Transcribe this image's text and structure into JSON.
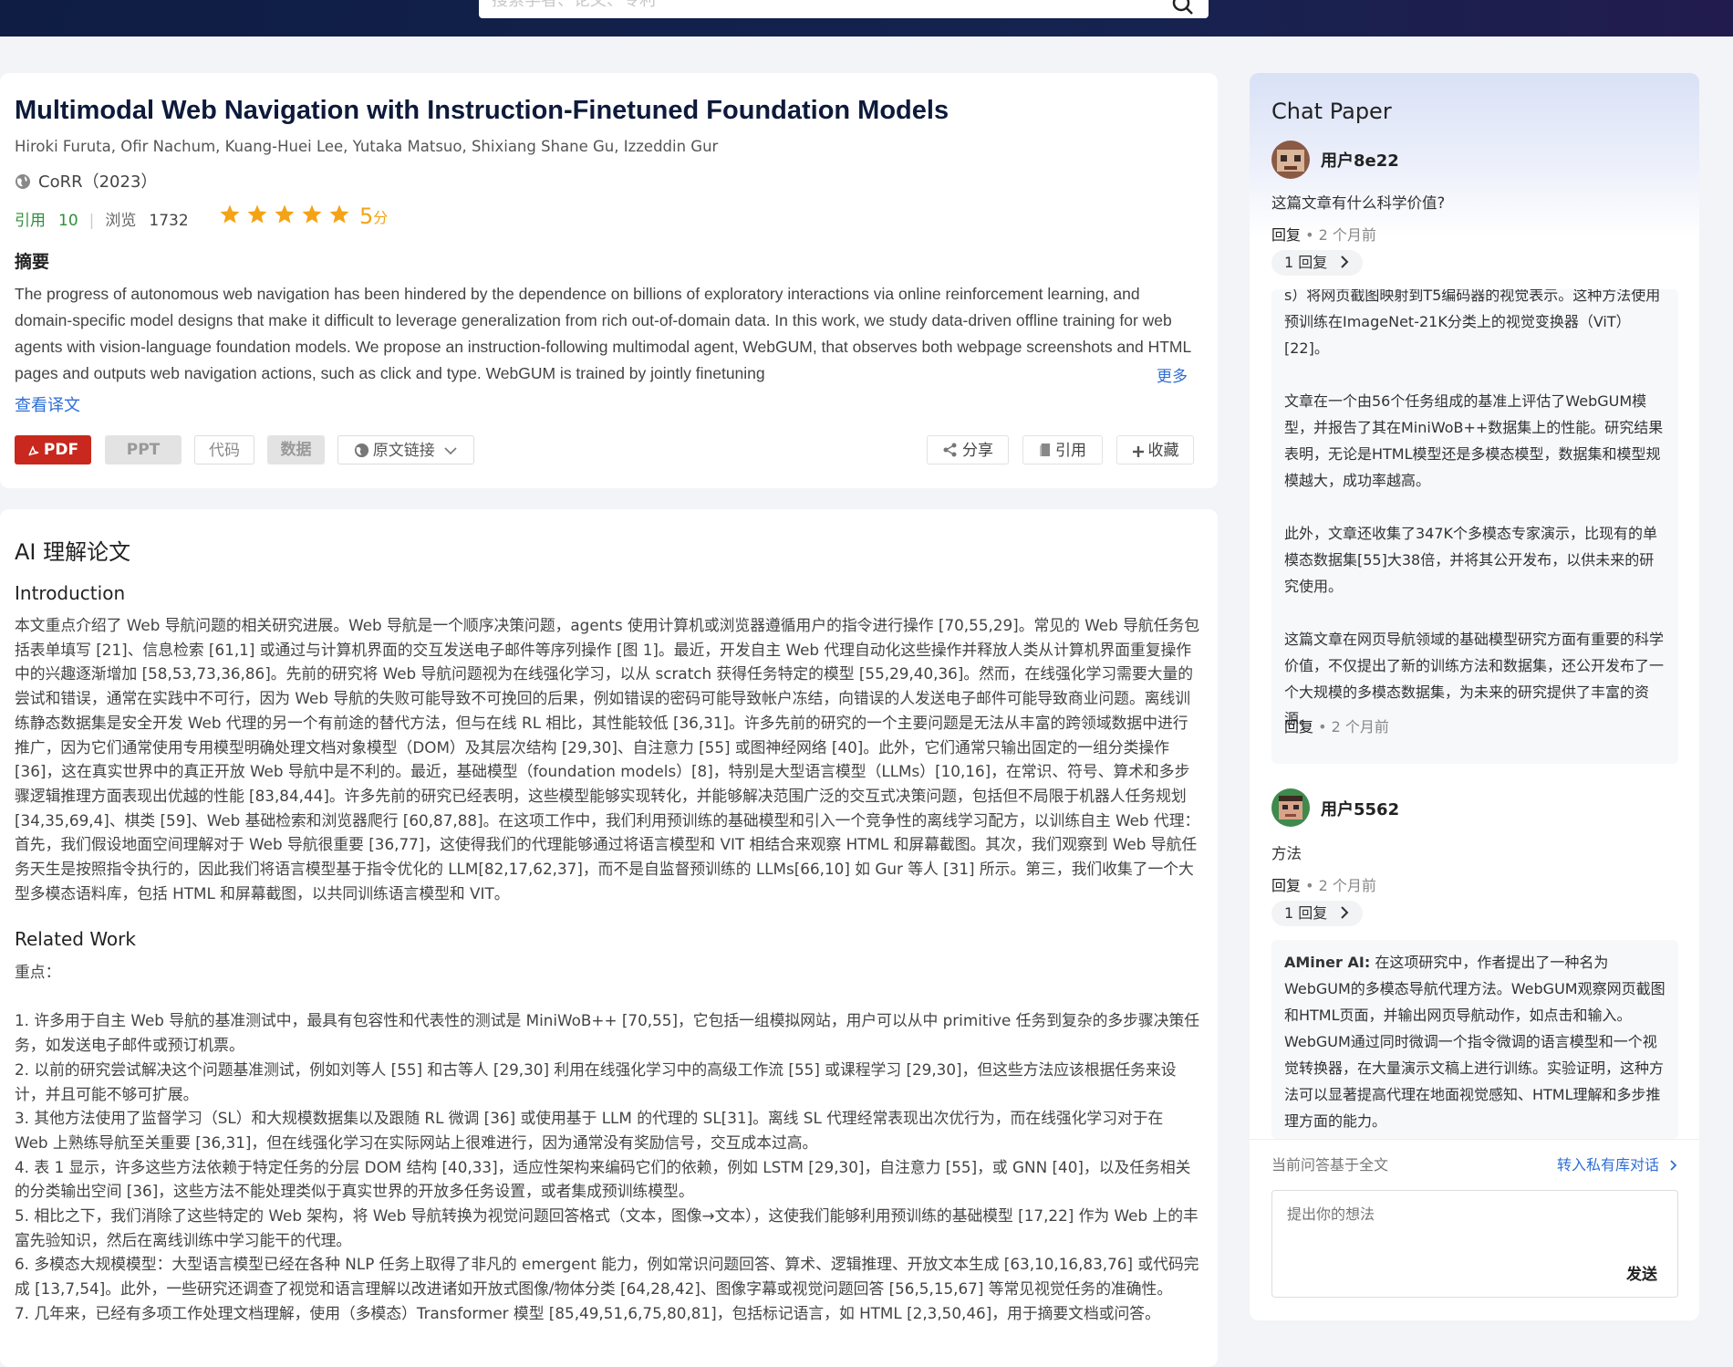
{
  "search": {
    "placeholder": "搜索学者、论文、专利"
  },
  "paper": {
    "title": "Multimodal Web Navigation with Instruction-Finetuned Foundation Models",
    "authors": "Hiroki Furuta, Ofir Nachum, Kuang-Huei Lee, Yutaka Matsuo, Shixiang Shane Gu, Izzeddin Gur",
    "venue": "CoRR（2023）",
    "cite_label": "引用",
    "cite_count": "10",
    "view_label": "浏览",
    "view_count": "1732",
    "rating": 5,
    "score": "5",
    "score_unit": "分",
    "abstract_heading": "摘要",
    "abstract": "The progress of autonomous web navigation has been hindered by the dependence on billions of exploratory interactions via online reinforcement learning, and domain-specific model designs that make it difficult to leverage generalization from rich out-of-domain data. In this work, we study data-driven offline training for web agents with vision-language foundation models. We propose an instruction-following multimodal agent, WebGUM, that observes both webpage screenshots and HTML pages and outputs web navigation actions, such as click and type. WebGUM is trained by jointly finetuning",
    "more_label": "更多",
    "translate_label": "查看译文",
    "buttons": {
      "pdf": "PDF",
      "ppt": "PPT",
      "code": "代码",
      "data": "数据",
      "source": "原文链接",
      "share": "分享",
      "cite": "引用",
      "favorite": "收藏"
    }
  },
  "ai": {
    "heading": "AI 理解论文",
    "intro_heading": "Introduction",
    "intro": [
      "本文重点介绍了 Web 导航问题的相关研究进展。Web 导航是一个顺序决策问题，agents 使用计算机或浏览器遵循用户的指令进行操作 [70,55,29]。常见的 Web 导航任务包括表单填写 [21]、信息检索 [61,1] 或通过与计算机界面的交互发送电子邮件等序列操作 [图 1]。最近，开发自主 Web 代理自动化这些操作并释放人类从计算机界面重复操作中的兴趣逐渐增加 [58,53,73,36,86]。先前的研究将 Web 导航问题视为在线强化学习，以从 scratch 获得任务特定的模型 [55,29,40,36]。然而，在线强化学习需要大量的尝试和错误，通常在实践中不可行，因为 Web 导航的失败可能导致不可挽回的后果，例如错误的密码可能导致帐户冻结，向错误的人发送电子邮件可能导致商业问题。离线训练静态数据集是安全开发 Web 代理的另一个有前途的替代方法，但与在线 RL 相比，其性能较低 [36,31]。许多先前的研究的一个主要问题是无法从丰富的跨领域数据中进行推广，因为它们通常使用专用模型明确处理文档对象模型（DOM）及其层次结构 [29,30]、自注意力 [55] 或图神经网络 [40]。此外，它们通常只输出固定的一组分类操作 [36]，这在真实世界中的真正开放 Web 导航中是不利的。最近，基础模型（foundation models）[8]，特别是大型语言模型（LLMs）[10,16]，在常识、符号、算术和多步骤逻辑推理方面表现出优越的性能 [83,84,44]。许多先前的研究已经表明，这些模型能够实现转化，并能够解决范围广泛的交互式决策问题，包括但不局限于机器人任务规划 [34,35,69,4]、棋类 [59]、Web 基础检索和浏览器爬行 [60,87,88]。在这项工作中，我们利用预训练的基础模型和引入一个竞争性的离线学习配方，以训练自主 Web 代理：首先，我们假设地面空间理解对于 Web 导航很重要 [36,77]，这使得我们的代理能够通过将语言模型和 VIT 相结合来观察 HTML 和屏幕截图。其次，我们观察到 Web 导航任务天生是按照指令执行的，因此我们将语言模型基于指令优化的 LLM[82,17,62,37]，而不是自监督预训练的 LLMs[66,10] 如 Gur 等人 [31] 所示。第三，我们收集了一个大型多模态语料库，包括 HTML 和屏幕截图，以共同训练语言模型和 VIT。"
    ],
    "related_heading": "Related Work",
    "related": [
      "重点：",
      "",
      "1. 许多用于自主 Web 导航的基准测试中，最具有包容性和代表性的测试是 MiniWoB++ [70,55]，它包括一组模拟网站，用户可以从中 primitive 任务到复杂的多步骤决策任务，如发送电子邮件或预订机票。",
      "2. 以前的研究尝试解决这个问题基准测试，例如刘等人 [55] 和古等人 [29,30] 利用在线强化学习中的高级工作流 [55] 或课程学习 [29,30]，但这些方法应该根据任务来设计，并且可能不够可扩展。",
      "3. 其他方法使用了监督学习（SL）和大规模数据集以及跟随 RL 微调 [36] 或使用基于 LLM 的代理的 SL[31]。离线 SL 代理经常表现出次优行为，而在线强化学习对于在 Web 上熟练导航至关重要 [36,31]，但在线强化学习在实际网站上很难进行，因为通常没有奖励信号，交互成本过高。",
      "4. 表 1 显示，许多这些方法依赖于特定任务的分层 DOM 结构 [40,33]，适应性架构来编码它们的依赖，例如 LSTM [29,30]，自注意力 [55]，或 GNN [40]，以及任务相关的分类输出空间 [36]，这些方法不能处理类似于真实世界的开放多任务设置，或者集成预训练模型。",
      "5. 相比之下，我们消除了这些特定的 Web 架构，将 Web 导航转换为视觉问题回答格式（文本，图像→文本），这使我们能够利用预训练的基础模型 [17,22] 作为 Web 上的丰富先验知识，然后在离线训练中学习能干的代理。",
      "6. 多模态大规模模型：大型语言模型已经在各种 NLP 任务上取得了非凡的 emergent 能力，例如常识问题回答、算术、逻辑推理、开放文本生成 [63,10,16,83,76] 或代码完成 [13,7,54]。此外，一些研究还调查了视觉和语言理解以改进诸如开放式图像/物体分类 [64,28,42]、图像字幕或视觉问题回答 [56,5,15,67] 等常见视觉任务的准确性。",
      "7. 几年来，已经有多项工作处理文档理解，使用（多模态）Transformer 模型 [85,49,51,6,75,80,81]，包括标记语言，如 HTML [2,3,50,46]，用于摘要文档或问答。"
    ]
  },
  "chat": {
    "title": "Chat Paper",
    "threads": [
      {
        "user": "用户8e22",
        "question": "这篇文章有什么科学价值?",
        "reply_label": "回复",
        "time": "2 个月前",
        "replies": "1 回复",
        "answer_paragraphs": [
          "s）将网页截图映射到T5编码器的视觉表示。这种方法使用预训练在ImageNet-21K分类上的视觉变换器（ViT）[22]。",
          "文章在一个由56个任务组成的基准上评估了WebGUM模型，并报告了其在MiniWoB++数据集上的性能。研究结果表明，无论是HTML模型还是多模态模型，数据集和模型规模越大，成功率越高。",
          "此外，文章还收集了347K个多模态专家演示，比现有的单模态数据集[55]大38倍，并将其公开发布，以供未来的研究使用。",
          "这篇文章在网页导航领域的基础模型研究方面有重要的科学价值，不仅提出了新的训练方法和数据集，还公开发布了一个大规模的多模态数据集，为未来的研究提供了丰富的资源。"
        ],
        "answer_reply_label": "回复",
        "answer_time": "2 个月前"
      },
      {
        "user": "用户5562",
        "question": "方法",
        "reply_label": "回复",
        "time": "2 个月前",
        "replies": "1 回复",
        "answer_author": "AMiner AI:",
        "answer_text": "在这项研究中，作者提出了一种名为WebGUM的多模态导航代理方法。WebGUM观察网页截图和HTML页面，并输出网页导航动作，如点击和输入。WebGUM通过同时微调一个指令微调的语言模型和一个视觉转换器，在大量演示文稿上进行训练。实验证明，这种方法可以显著提高代理在地面视觉感知、HTML理解和多步推理方面的能力。"
      }
    ],
    "footer_note": "当前问答基于全文",
    "private_link": "转入私有库对话",
    "input_placeholder": "提出你的想法",
    "send": "发送"
  }
}
